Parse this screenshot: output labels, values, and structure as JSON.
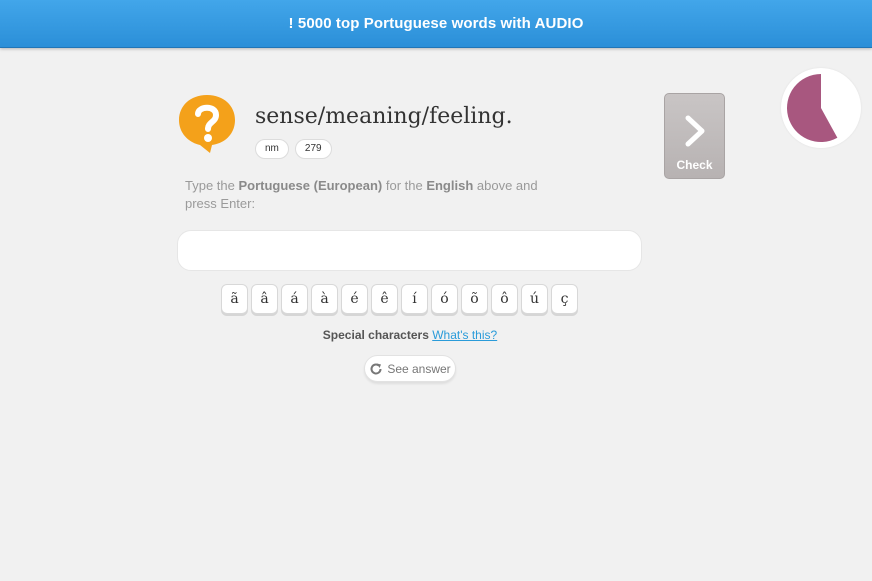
{
  "header": {
    "title": "! 5000 top Portuguese words with AUDIO"
  },
  "prompt": {
    "icon": "question-bubble-icon",
    "text": "sense/meaning/feeling.",
    "tags": [
      "nm",
      "279"
    ]
  },
  "instructions": {
    "prefix": "Type the ",
    "language": "Portuguese (European)",
    "middle": " for the ",
    "source": "English",
    "suffix": " above and press Enter:"
  },
  "answer": {
    "value": "",
    "placeholder": ""
  },
  "special_characters": {
    "keys": [
      "ã",
      "â",
      "á",
      "à",
      "é",
      "ê",
      "í",
      "ó",
      "õ",
      "ô",
      "ú",
      "ç"
    ],
    "label": "Special characters",
    "help_link": "What's this?"
  },
  "see_answer": {
    "label": "See answer",
    "icon": "refresh-icon"
  },
  "check_button": {
    "label": "Check",
    "icon": "chevron-right-icon"
  },
  "timer": {
    "remaining_fraction": 0.58,
    "color": "#a8577f"
  },
  "colors": {
    "header": "#2b8fd8",
    "accent_orange": "#f4a11a",
    "link": "#2a9bd9"
  }
}
